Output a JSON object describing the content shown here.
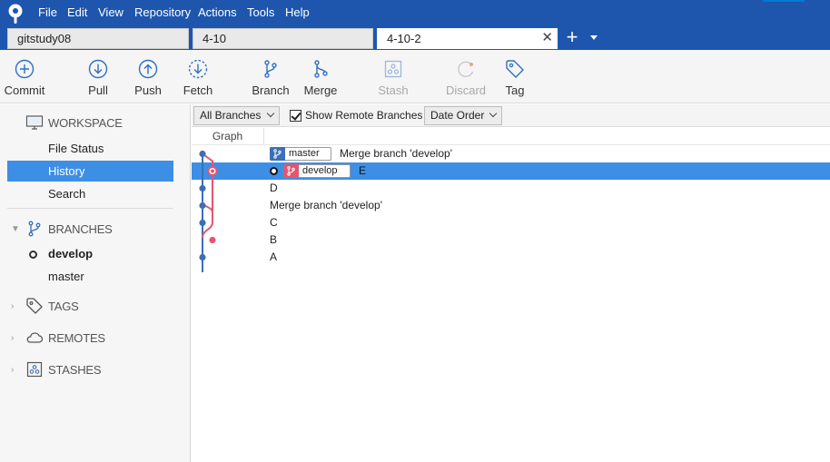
{
  "menu": {
    "items": [
      "File",
      "Edit",
      "View",
      "Repository",
      "Actions",
      "Tools",
      "Help"
    ]
  },
  "tabs": [
    {
      "label": "gitstudy08",
      "active": false
    },
    {
      "label": "4-10",
      "active": false
    },
    {
      "label": "4-10-2",
      "active": true
    }
  ],
  "tab_close_glyph": "✕",
  "tab_add_glyph": "+",
  "toolbar": {
    "commit": "Commit",
    "pull": "Pull",
    "push": "Push",
    "fetch": "Fetch",
    "branch": "Branch",
    "merge": "Merge",
    "stash": "Stash",
    "discard": "Discard",
    "tag": "Tag"
  },
  "sidebar": {
    "workspace": {
      "title": "WORKSPACE",
      "items": [
        "File Status",
        "History",
        "Search"
      ],
      "selected": "History"
    },
    "branches": {
      "title": "BRANCHES",
      "items": [
        "develop",
        "master"
      ],
      "current": "develop"
    },
    "tags": "TAGS",
    "remotes": "REMOTES",
    "stashes": "STASHES"
  },
  "filters": {
    "branches": "All Branches",
    "show_remote": "Show Remote Branches",
    "show_remote_checked": true,
    "order": "Date Order"
  },
  "history": {
    "graph_header": "Graph",
    "rows": [
      {
        "ref": "master",
        "message": "Merge branch 'develop'",
        "selected": false
      },
      {
        "ref": "develop",
        "message": "E",
        "selected": true
      },
      {
        "ref": "",
        "message": "D",
        "selected": false
      },
      {
        "ref": "",
        "message": "Merge branch 'develop'",
        "selected": false
      },
      {
        "ref": "",
        "message": "C",
        "selected": false
      },
      {
        "ref": "",
        "message": "B",
        "selected": false
      },
      {
        "ref": "",
        "message": "A",
        "selected": false
      }
    ]
  },
  "colors": {
    "titlebar": "#1e56ae",
    "selection": "#3d8fe6",
    "branch_blue": "#3b6fb6",
    "branch_pink": "#e3566e"
  }
}
